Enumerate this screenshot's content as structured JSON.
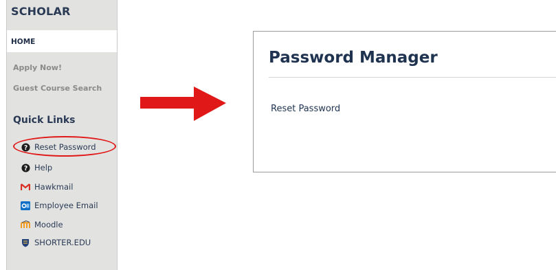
{
  "sidebar": {
    "brand": "SCHOLAR",
    "home": "HOME",
    "top_links": [
      "Apply Now!",
      "Guest Course Search"
    ],
    "quick_links_title": "Quick Links",
    "quick_links": [
      {
        "label": "Reset Password",
        "icon": "question-circle-icon"
      },
      {
        "label": "Help",
        "icon": "question-circle-icon"
      },
      {
        "label": "Hawkmail",
        "icon": "gmail-icon"
      },
      {
        "label": "Employee Email",
        "icon": "outlook-icon"
      },
      {
        "label": "Moodle",
        "icon": "moodle-icon"
      },
      {
        "label": "SHORTER.EDU",
        "icon": "shield-crest-icon"
      }
    ]
  },
  "panel": {
    "title": "Password Manager",
    "link": "Reset Password"
  },
  "colors": {
    "annotation_red": "#e01818",
    "navy_text": "#1f3350",
    "sidebar_bg": "#e2e2e0"
  }
}
